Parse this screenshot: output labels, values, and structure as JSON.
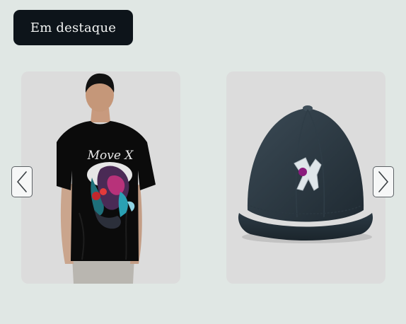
{
  "featured": {
    "label": "Em destaque"
  },
  "carousel": {
    "items": [
      {
        "product": "t-shirt",
        "print_text": "Move X"
      },
      {
        "product": "cap"
      }
    ],
    "prev_icon": "chevron-left-icon",
    "next_icon": "chevron-right-icon"
  },
  "colors": {
    "background": "#e0e7e4",
    "badge": "#0d141a",
    "card": "#dcdcdc",
    "cap": "#2c3a44",
    "shirt": "#0b0b0b"
  }
}
